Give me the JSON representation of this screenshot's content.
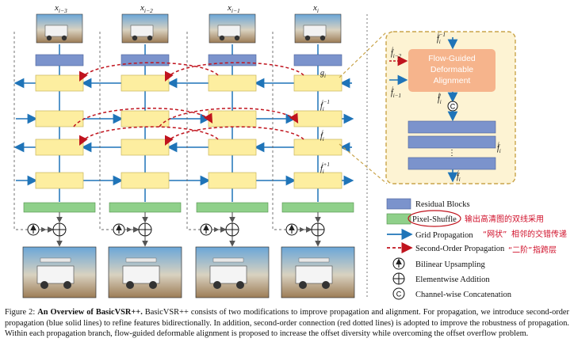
{
  "figure": {
    "frame_labels": [
      "x_{i-3}",
      "x_{i-2}",
      "x_{i-1}",
      "x_i"
    ],
    "frame_label_text": [
      "x",
      "x",
      "x",
      "x"
    ],
    "frame_label_sub": [
      "i−3",
      "i−2",
      "i−1",
      "i"
    ],
    "g_label": "g",
    "g_sub": "i",
    "f_labels": [
      {
        "base": "f",
        "sub": "i",
        "sup": "j−1"
      },
      {
        "base": "f",
        "sub": "i",
        "sup": "j"
      },
      {
        "base": "f",
        "sub": "i",
        "sup": "j+1"
      }
    ],
    "inset": {
      "title_lines": [
        "Flow-Guided",
        "Deformable",
        "Alignment"
      ],
      "inputs": [
        {
          "base": "f",
          "sub": "i−2",
          "sup": "j"
        },
        {
          "base": "f",
          "sub": "i−1",
          "sup": "j"
        }
      ],
      "top_input": {
        "base": "f",
        "sub": "i",
        "sup": "j−1"
      },
      "aligned": {
        "base": "f̂",
        "sub": "i",
        "sup": "j"
      },
      "concat_symbol": "C",
      "dots": "⋮",
      "side_output": {
        "base": "f",
        "sub": "i",
        "sup": "j"
      },
      "bottom_output": {
        "base": "f",
        "sub": "i",
        "sup": "j"
      }
    }
  },
  "legend": {
    "items": [
      {
        "label": "Residual Blocks",
        "icon": "residual-block-swatch"
      },
      {
        "label": "Pixel-Shuffle",
        "icon": "pixel-shuffle-swatch"
      },
      {
        "label": "Grid Propagation",
        "icon": "blue-arrow-icon"
      },
      {
        "label": "Second-Order Propagation",
        "icon": "red-dashed-arrow-icon"
      },
      {
        "label": "Bilinear Upsampling",
        "icon": "up-arrow-circle-icon"
      },
      {
        "label": "Elementwise Addition",
        "icon": "circle-plus-icon"
      },
      {
        "label": "Channel-wise Concatenation",
        "icon": "circle-c-icon"
      }
    ]
  },
  "handwritten_notes": [
    "输出高清图的双线采用",
    "“网状”",
    "相邻的交错传递",
    "“二阶”",
    "指跨层"
  ],
  "caption": {
    "prefix": "Figure 2: ",
    "bold": "An Overview of BasicVSR++.",
    "body": " BasicVSR++ consists of two modifications to improve propagation and alignment. For propagation, we introduce second-order propagation (blue solid lines) to refine features bidirectionally. In addition, second-order connection (red dotted lines) is adopted to improve the robustness of propagation. Within each propagation branch, flow-guided deformable alignment is proposed to increase the offset diversity while overcoming the offset overflow problem."
  },
  "colors": {
    "residual_block": "#7b93cc",
    "prop_block": "#fdeea0",
    "pixel_shuffle": "#8fd08a",
    "grid_arrow": "#1f74b8",
    "second_order": "#c0141e",
    "inset_border": "#c9a44a",
    "inset_bg": "#fdf3d3",
    "fgda_box": "#f6b48c"
  }
}
